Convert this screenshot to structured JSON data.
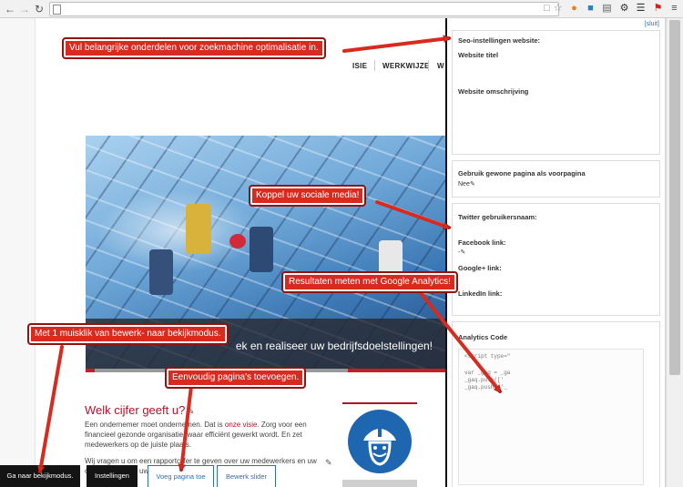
{
  "website": {
    "menu": [
      "ISIE",
      "WERKWIJZE",
      "W"
    ],
    "hero_caption": "ek en realiseer uw bedrijfsdoelstellingen!",
    "section_title": "Welk cijfer geeft u?",
    "para1_before": "Een ondernemer moet ondernemen. Dat is ",
    "para1_link": "onze visie",
    "para1_after": ". Zorg voor een financieel gezonde organisatie, waar efficiënt gewerkt wordt. En zet medewerkers op de juiste plaats.",
    "para2": "Wij vragen u om een rapportcijfer te geven over uw medewerkers en uw onderneming en uw winkel!"
  },
  "panel": {
    "close_label": "[sluit]",
    "seo_heading": "Seo-instellingen website:",
    "site_title_label": "Website titel",
    "site_desc_label": "Website omschrijving",
    "homepage_label": "Gebruik gewone pagina als voorpagina",
    "homepage_value": "Nee",
    "twitter_label": "Twitter gebruikersnaam:",
    "facebook_label": "Facebook link:",
    "facebook_value": "-",
    "google_label": "Google+ link:",
    "linkedin_label": "LinkedIn link:",
    "analytics_label": "Analytics Code",
    "code_lines": [
      "<script type=\"",
      "",
      "var _gaq = _ga",
      "_gaq.push(['",
      "_gaq.push(['_"
    ]
  },
  "admin_bar": {
    "view_mode": "Ga naar bekijkmodus.",
    "settings": "Instellingen",
    "add_page": "Voeg pagina toe",
    "edit_slider": "Bewerk slider"
  },
  "annotations": {
    "seo": "Vul belangrijke onderdelen voor zoekmachine optimalisatie in.",
    "social": "Koppel uw sociale media!",
    "analytics": "Resultaten meten met Google Analytics!",
    "view_mode": "Met 1 muisklik van bewerk- naar bekijkmodus.",
    "pages": "Eenvoudig pagina's toevoegen."
  },
  "colors": {
    "brand_red": "#b0132a",
    "callout_red": "#d82a1f",
    "link_blue": "#2f6fb0"
  }
}
